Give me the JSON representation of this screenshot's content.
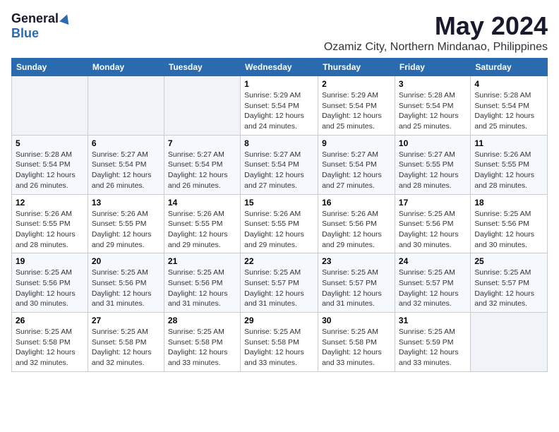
{
  "logo": {
    "general": "General",
    "blue": "Blue"
  },
  "title": "May 2024",
  "subtitle": "Ozamiz City, Northern Mindanao, Philippines",
  "days_of_week": [
    "Sunday",
    "Monday",
    "Tuesday",
    "Wednesday",
    "Thursday",
    "Friday",
    "Saturday"
  ],
  "weeks": [
    [
      {
        "day": "",
        "sunrise": "",
        "sunset": "",
        "daylight": ""
      },
      {
        "day": "",
        "sunrise": "",
        "sunset": "",
        "daylight": ""
      },
      {
        "day": "",
        "sunrise": "",
        "sunset": "",
        "daylight": ""
      },
      {
        "day": "1",
        "sunrise": "Sunrise: 5:29 AM",
        "sunset": "Sunset: 5:54 PM",
        "daylight": "Daylight: 12 hours and 24 minutes."
      },
      {
        "day": "2",
        "sunrise": "Sunrise: 5:29 AM",
        "sunset": "Sunset: 5:54 PM",
        "daylight": "Daylight: 12 hours and 25 minutes."
      },
      {
        "day": "3",
        "sunrise": "Sunrise: 5:28 AM",
        "sunset": "Sunset: 5:54 PM",
        "daylight": "Daylight: 12 hours and 25 minutes."
      },
      {
        "day": "4",
        "sunrise": "Sunrise: 5:28 AM",
        "sunset": "Sunset: 5:54 PM",
        "daylight": "Daylight: 12 hours and 25 minutes."
      }
    ],
    [
      {
        "day": "5",
        "sunrise": "Sunrise: 5:28 AM",
        "sunset": "Sunset: 5:54 PM",
        "daylight": "Daylight: 12 hours and 26 minutes."
      },
      {
        "day": "6",
        "sunrise": "Sunrise: 5:27 AM",
        "sunset": "Sunset: 5:54 PM",
        "daylight": "Daylight: 12 hours and 26 minutes."
      },
      {
        "day": "7",
        "sunrise": "Sunrise: 5:27 AM",
        "sunset": "Sunset: 5:54 PM",
        "daylight": "Daylight: 12 hours and 26 minutes."
      },
      {
        "day": "8",
        "sunrise": "Sunrise: 5:27 AM",
        "sunset": "Sunset: 5:54 PM",
        "daylight": "Daylight: 12 hours and 27 minutes."
      },
      {
        "day": "9",
        "sunrise": "Sunrise: 5:27 AM",
        "sunset": "Sunset: 5:54 PM",
        "daylight": "Daylight: 12 hours and 27 minutes."
      },
      {
        "day": "10",
        "sunrise": "Sunrise: 5:27 AM",
        "sunset": "Sunset: 5:55 PM",
        "daylight": "Daylight: 12 hours and 28 minutes."
      },
      {
        "day": "11",
        "sunrise": "Sunrise: 5:26 AM",
        "sunset": "Sunset: 5:55 PM",
        "daylight": "Daylight: 12 hours and 28 minutes."
      }
    ],
    [
      {
        "day": "12",
        "sunrise": "Sunrise: 5:26 AM",
        "sunset": "Sunset: 5:55 PM",
        "daylight": "Daylight: 12 hours and 28 minutes."
      },
      {
        "day": "13",
        "sunrise": "Sunrise: 5:26 AM",
        "sunset": "Sunset: 5:55 PM",
        "daylight": "Daylight: 12 hours and 29 minutes."
      },
      {
        "day": "14",
        "sunrise": "Sunrise: 5:26 AM",
        "sunset": "Sunset: 5:55 PM",
        "daylight": "Daylight: 12 hours and 29 minutes."
      },
      {
        "day": "15",
        "sunrise": "Sunrise: 5:26 AM",
        "sunset": "Sunset: 5:55 PM",
        "daylight": "Daylight: 12 hours and 29 minutes."
      },
      {
        "day": "16",
        "sunrise": "Sunrise: 5:26 AM",
        "sunset": "Sunset: 5:56 PM",
        "daylight": "Daylight: 12 hours and 29 minutes."
      },
      {
        "day": "17",
        "sunrise": "Sunrise: 5:25 AM",
        "sunset": "Sunset: 5:56 PM",
        "daylight": "Daylight: 12 hours and 30 minutes."
      },
      {
        "day": "18",
        "sunrise": "Sunrise: 5:25 AM",
        "sunset": "Sunset: 5:56 PM",
        "daylight": "Daylight: 12 hours and 30 minutes."
      }
    ],
    [
      {
        "day": "19",
        "sunrise": "Sunrise: 5:25 AM",
        "sunset": "Sunset: 5:56 PM",
        "daylight": "Daylight: 12 hours and 30 minutes."
      },
      {
        "day": "20",
        "sunrise": "Sunrise: 5:25 AM",
        "sunset": "Sunset: 5:56 PM",
        "daylight": "Daylight: 12 hours and 31 minutes."
      },
      {
        "day": "21",
        "sunrise": "Sunrise: 5:25 AM",
        "sunset": "Sunset: 5:56 PM",
        "daylight": "Daylight: 12 hours and 31 minutes."
      },
      {
        "day": "22",
        "sunrise": "Sunrise: 5:25 AM",
        "sunset": "Sunset: 5:57 PM",
        "daylight": "Daylight: 12 hours and 31 minutes."
      },
      {
        "day": "23",
        "sunrise": "Sunrise: 5:25 AM",
        "sunset": "Sunset: 5:57 PM",
        "daylight": "Daylight: 12 hours and 31 minutes."
      },
      {
        "day": "24",
        "sunrise": "Sunrise: 5:25 AM",
        "sunset": "Sunset: 5:57 PM",
        "daylight": "Daylight: 12 hours and 32 minutes."
      },
      {
        "day": "25",
        "sunrise": "Sunrise: 5:25 AM",
        "sunset": "Sunset: 5:57 PM",
        "daylight": "Daylight: 12 hours and 32 minutes."
      }
    ],
    [
      {
        "day": "26",
        "sunrise": "Sunrise: 5:25 AM",
        "sunset": "Sunset: 5:58 PM",
        "daylight": "Daylight: 12 hours and 32 minutes."
      },
      {
        "day": "27",
        "sunrise": "Sunrise: 5:25 AM",
        "sunset": "Sunset: 5:58 PM",
        "daylight": "Daylight: 12 hours and 32 minutes."
      },
      {
        "day": "28",
        "sunrise": "Sunrise: 5:25 AM",
        "sunset": "Sunset: 5:58 PM",
        "daylight": "Daylight: 12 hours and 33 minutes."
      },
      {
        "day": "29",
        "sunrise": "Sunrise: 5:25 AM",
        "sunset": "Sunset: 5:58 PM",
        "daylight": "Daylight: 12 hours and 33 minutes."
      },
      {
        "day": "30",
        "sunrise": "Sunrise: 5:25 AM",
        "sunset": "Sunset: 5:58 PM",
        "daylight": "Daylight: 12 hours and 33 minutes."
      },
      {
        "day": "31",
        "sunrise": "Sunrise: 5:25 AM",
        "sunset": "Sunset: 5:59 PM",
        "daylight": "Daylight: 12 hours and 33 minutes."
      },
      {
        "day": "",
        "sunrise": "",
        "sunset": "",
        "daylight": ""
      }
    ]
  ]
}
